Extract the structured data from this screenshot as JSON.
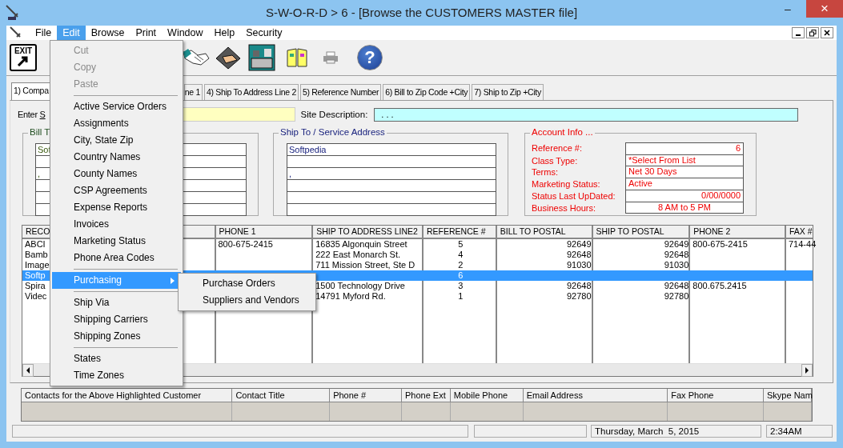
{
  "window": {
    "title": "S-W-O-R-D > 6 - [Browse the CUSTOMERS MASTER file]",
    "buttons": [
      {
        "kind": "minimize",
        "label": "–"
      },
      {
        "kind": "close",
        "label": "×"
      }
    ]
  },
  "menu_bar": [
    {
      "label": "File",
      "selected": false
    },
    {
      "label": "Edit",
      "selected": true
    },
    {
      "label": "Browse",
      "selected": false
    },
    {
      "label": "Print",
      "selected": false
    },
    {
      "label": "Window",
      "selected": false
    },
    {
      "label": "Help",
      "selected": false
    },
    {
      "label": "Security",
      "selected": false
    }
  ],
  "toolbar": [
    {
      "kind": "exit",
      "label": "EXIT"
    },
    {
      "kind": "handshake"
    },
    {
      "kind": "hand-book"
    },
    {
      "kind": "office"
    },
    {
      "kind": "book"
    },
    {
      "kind": "printer"
    },
    {
      "kind": "help",
      "label": "?"
    }
  ],
  "edit_menu": [
    {
      "kind": "item",
      "label": "Cut",
      "disabled": true,
      "selected": false
    },
    {
      "kind": "item",
      "label": "Copy",
      "disabled": true,
      "selected": false
    },
    {
      "kind": "item",
      "label": "Paste",
      "disabled": true,
      "selected": false
    },
    {
      "kind": "separator"
    },
    {
      "kind": "item",
      "label": "Active Service Orders",
      "disabled": false,
      "selected": false
    },
    {
      "kind": "item",
      "label": "Assignments",
      "disabled": false,
      "selected": false
    },
    {
      "kind": "item",
      "label": "City, State Zip",
      "disabled": false,
      "selected": false
    },
    {
      "kind": "item",
      "label": "Country Names",
      "disabled": false,
      "selected": false
    },
    {
      "kind": "item",
      "label": "County Names",
      "disabled": false,
      "selected": false
    },
    {
      "kind": "item",
      "label": "CSP Agreements",
      "disabled": false,
      "selected": false
    },
    {
      "kind": "item",
      "label": "Expense Reports",
      "disabled": false,
      "selected": false
    },
    {
      "kind": "item",
      "label": "Invoices",
      "disabled": false,
      "selected": false
    },
    {
      "kind": "item",
      "label": "Marketing Status",
      "disabled": false,
      "selected": false
    },
    {
      "kind": "item",
      "label": "Phone Area Codes",
      "disabled": false,
      "selected": false
    },
    {
      "kind": "separator"
    },
    {
      "kind": "submenu",
      "label": "Purchasing",
      "disabled": false,
      "selected": true
    },
    {
      "kind": "separator"
    },
    {
      "kind": "item",
      "label": "Ship Via",
      "disabled": false,
      "selected": false
    },
    {
      "kind": "item",
      "label": "Shipping Carriers",
      "disabled": false,
      "selected": false
    },
    {
      "kind": "item",
      "label": "Shipping Zones",
      "disabled": false,
      "selected": false
    },
    {
      "kind": "separator"
    },
    {
      "kind": "item",
      "label": "States",
      "disabled": false,
      "selected": false
    },
    {
      "kind": "item",
      "label": "Time Zones",
      "disabled": false,
      "selected": false
    }
  ],
  "submenu": [
    {
      "label": "Purchase Orders",
      "selected": false
    },
    {
      "label": "Suppliers and Vendors",
      "selected": false
    }
  ],
  "tabs": [
    {
      "label": "1) Compa",
      "selected": true
    },
    {
      "label": "ne 1",
      "selected": false
    },
    {
      "label": "4) Ship To Address Line 2",
      "selected": false
    },
    {
      "label": "5) Reference Number",
      "selected": false
    },
    {
      "label": "6) Bill to Zip Code +City",
      "selected": false
    },
    {
      "label": "7) Ship to Zip +City",
      "selected": false
    }
  ],
  "site": {
    "label": "Enter ",
    "accelerator": "S",
    "description_label": "Site Description:",
    "description_value": ". . ."
  },
  "bill_to": {
    "legend": "Bill T",
    "line_1": "Sof",
    "line_3": ","
  },
  "ship_to": {
    "legend": "Ship To / Service Address",
    "line_1": "Softpedia",
    "line_3": ","
  },
  "account_info": {
    "legend": "Account Info ...",
    "fields": [
      {
        "label": "Reference #:",
        "value": "6",
        "kind": "number"
      },
      {
        "label": "Class Type:",
        "value": "*Select From List",
        "kind": "text"
      },
      {
        "label": "Terms:",
        "value": "Net 30 Days",
        "kind": "text"
      },
      {
        "label": "Marketing Status:",
        "value": "Active",
        "kind": "text"
      },
      {
        "label": "Status Last UpDated:",
        "value": "0/00/0000",
        "kind": "number"
      },
      {
        "label": "Business Hours:",
        "value": "8 AM to 5 PM",
        "kind": "range"
      }
    ]
  },
  "customers_grid": {
    "columns": [
      {
        "label": "RECO"
      },
      {},
      {
        "label": "PHONE 1"
      },
      {
        "label": "SHIP TO ADDRESS LINE2"
      },
      {
        "label": "REFERENCE #"
      },
      {
        "label": "BILL TO POSTAL"
      },
      {
        "label": "SHIP TO POSTAL"
      },
      {
        "label": "PHONE 2"
      },
      {
        "label": "FAX #"
      }
    ],
    "rows": [
      {
        "selected": false,
        "cells": [
          {
            "text": "ABCI"
          },
          {},
          {
            "text": "800-675-2415"
          },
          {
            "text": "16835 Algonquin Street"
          },
          {
            "text": "5"
          },
          {
            "text": "92649"
          },
          {
            "text": "92649"
          },
          {
            "text": "800-675-2415"
          },
          {
            "text": "714-44"
          }
        ]
      },
      {
        "selected": false,
        "cells": [
          {
            "text": "Bamb"
          },
          {},
          {},
          {
            "text": "222 East Monarch St."
          },
          {
            "text": "4"
          },
          {
            "text": "92648"
          },
          {
            "text": "92648"
          },
          {},
          {}
        ]
      },
      {
        "selected": false,
        "cells": [
          {
            "text": "Image"
          },
          {},
          {},
          {
            "text": "711 Mission Street, Ste D"
          },
          {
            "text": "2"
          },
          {
            "text": "91030"
          },
          {
            "text": "91030"
          },
          {},
          {}
        ]
      },
      {
        "selected": true,
        "cells": [
          {
            "text": "Softp"
          },
          {},
          {},
          {},
          {
            "text": "6"
          },
          {},
          {},
          {},
          {}
        ]
      },
      {
        "selected": false,
        "cells": [
          {
            "text": "Spira"
          },
          {},
          {},
          {
            "text": "1500 Technology Drive"
          },
          {
            "text": "3"
          },
          {
            "text": "92648"
          },
          {
            "text": "92648"
          },
          {
            "text": "800.675.2415"
          },
          {}
        ]
      },
      {
        "selected": false,
        "cells": [
          {
            "text": "Videc"
          },
          {},
          {},
          {
            "text": "14791 Myford Rd."
          },
          {
            "text": "1"
          },
          {
            "text": "92780"
          },
          {
            "text": "92780"
          },
          {},
          {}
        ]
      }
    ]
  },
  "contacts_grid": {
    "columns": [
      "Contacts for the Above Highlighted Customer",
      "Contact Title",
      "Phone #",
      "Phone Ext",
      "Mobile Phone",
      "Email Address",
      "Fax Phone",
      "Skype Nam"
    ]
  },
  "status_bar": {
    "date": "Thursday, March  5, 2015",
    "time": "2:34AM"
  }
}
